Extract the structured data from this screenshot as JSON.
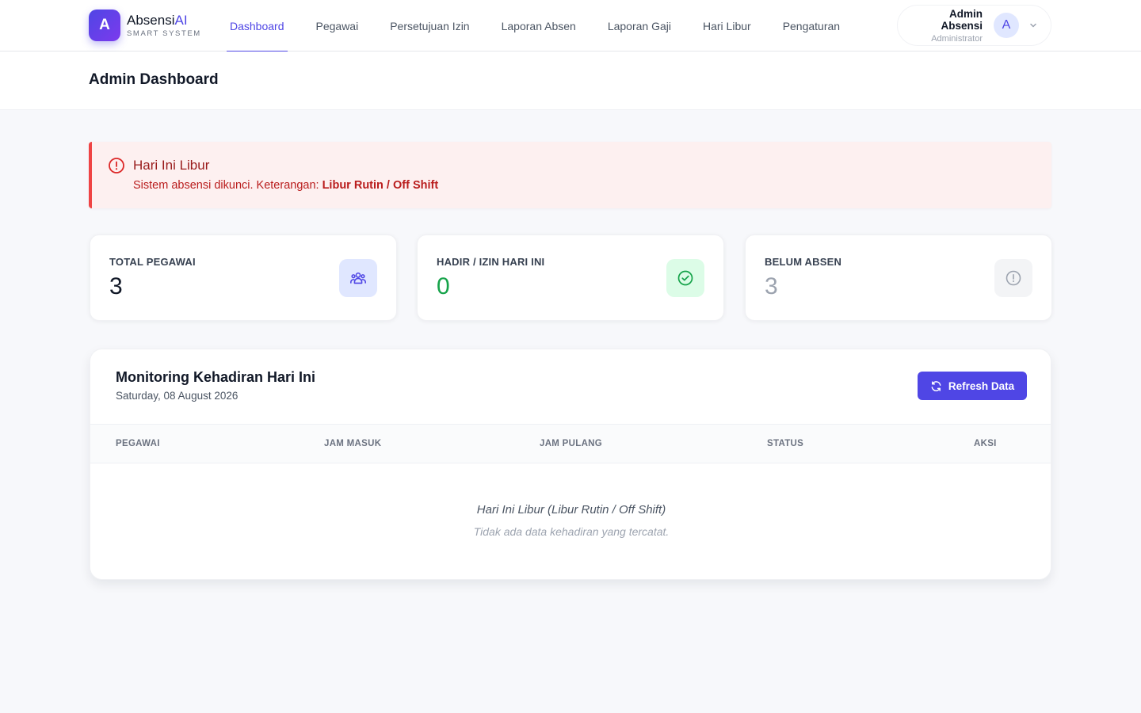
{
  "brand": {
    "logo_letter": "A",
    "name_main": "Absensi",
    "name_accent": "AI",
    "subtitle": "SMART SYSTEM"
  },
  "nav": {
    "items": [
      {
        "label": "Dashboard",
        "active": true
      },
      {
        "label": "Pegawai"
      },
      {
        "label": "Persetujuan Izin"
      },
      {
        "label": "Laporan Absen"
      },
      {
        "label": "Laporan Gaji"
      },
      {
        "label": "Hari Libur"
      },
      {
        "label": "Pengaturan"
      }
    ]
  },
  "user": {
    "name": "Admin Absensi",
    "role": "Administrator",
    "avatar_letter": "A"
  },
  "page": {
    "title": "Admin Dashboard"
  },
  "alert": {
    "title": "Hari Ini Libur",
    "message_prefix": "Sistem absensi dikunci. Keterangan: ",
    "message_highlight": "Libur Rutin / Off Shift"
  },
  "stats": [
    {
      "label": "TOTAL PEGAWAI",
      "value": "3",
      "icon": "users-icon",
      "color": "#111827",
      "icon_bg": "#e0e7ff",
      "icon_color": "#4f46e5"
    },
    {
      "label": "HADIR / IZIN HARI INI",
      "value": "0",
      "icon": "check-circle-icon",
      "color": "#16a34a",
      "icon_bg": "#dcfce7",
      "icon_color": "#16a34a"
    },
    {
      "label": "BELUM ABSEN",
      "value": "3",
      "icon": "alert-circle-icon",
      "color": "#9ca3af",
      "icon_bg": "#f3f4f6",
      "icon_color": "#9ca3af"
    }
  ],
  "monitoring": {
    "title": "Monitoring Kehadiran Hari Ini",
    "date": "Saturday, 08 August 2026",
    "refresh_label": "Refresh Data",
    "columns": [
      "PEGAWAI",
      "JAM MASUK",
      "JAM PULANG",
      "STATUS",
      "AKSI"
    ],
    "empty_title": "Hari Ini Libur (Libur Rutin / Off Shift)",
    "empty_subtitle": "Tidak ada data kehadiran yang tercatat."
  },
  "colors": {
    "accent": "#4f46e5",
    "danger": "#ef4444",
    "success": "#16a34a"
  }
}
